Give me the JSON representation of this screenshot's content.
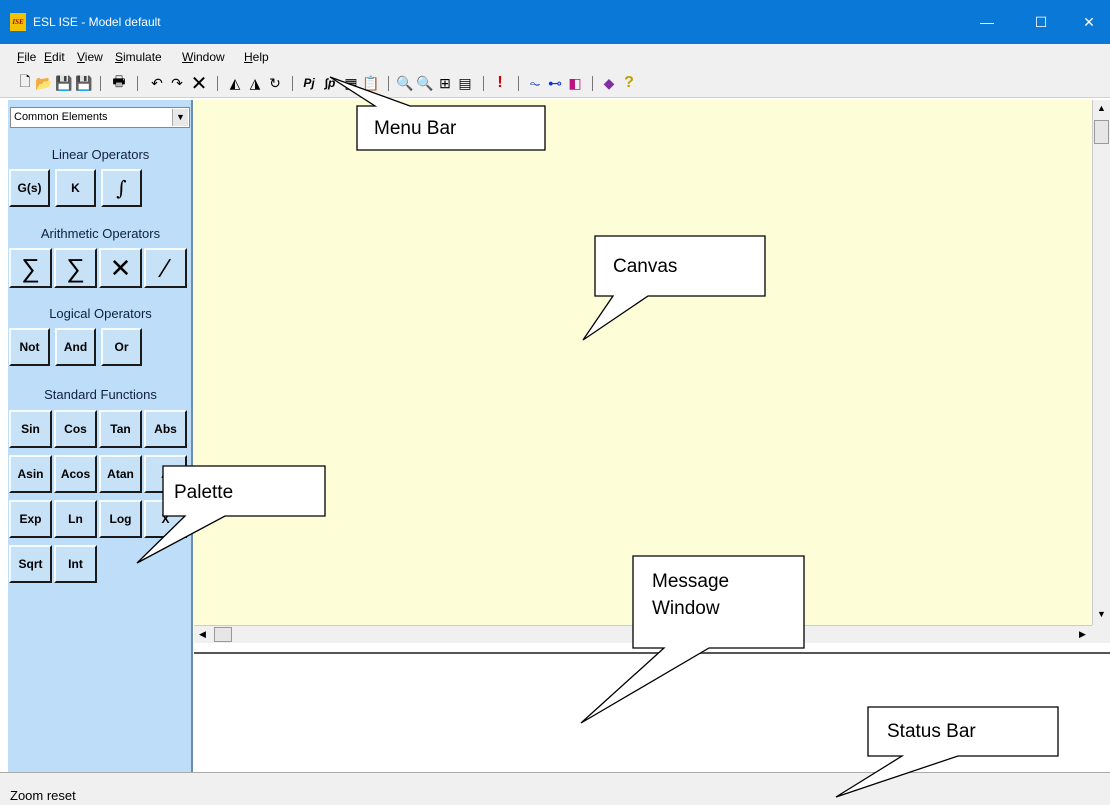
{
  "window": {
    "title": "ESL ISE - Model default",
    "app_icon_glyph": "ISE",
    "minimize_glyph": "—",
    "maximize_glyph": "☐",
    "close_glyph": "✕"
  },
  "menu": [
    {
      "underline": "F",
      "rest": "ile"
    },
    {
      "underline": "E",
      "rest": "dit"
    },
    {
      "underline": "V",
      "rest": "iew"
    },
    {
      "underline": "S",
      "rest": "imulate"
    },
    {
      "underline": "W",
      "rest": "indow"
    },
    {
      "underline": "H",
      "rest": "elp"
    }
  ],
  "toolbar": {
    "icons": [
      "new-file-icon",
      "open-file-icon",
      "save-icon",
      "save-all-icon",
      "print-icon",
      "undo-icon",
      "redo-icon",
      "delete-icon",
      "flip-horizontal-icon",
      "flip-vertical-icon",
      "rotate-icon",
      "parameters-icon",
      "integration-params-icon",
      "compile-icon",
      "properties-icon",
      "zoom-in-icon",
      "zoom-reset-icon",
      "zoom-fit-icon",
      "grid-icon",
      "run-icon",
      "plot-icon",
      "connector-icon",
      "block-3d-icon",
      "book-icon",
      "help-icon"
    ],
    "glyphs": [
      "🗋",
      "📂",
      "💾",
      "💾",
      "🖶",
      "↶",
      "↷",
      "✕",
      "◭",
      "◮",
      "↻",
      "Pj",
      "∫p",
      "▦",
      "📋",
      "🔍",
      "🔍",
      "⊞",
      "▤",
      "!",
      "⏦",
      "⊷",
      "◧",
      "◆",
      "?"
    ]
  },
  "palette": {
    "selector_value": "Common Elements",
    "sections": {
      "linear": "Linear Operators",
      "arithmetic": "Arithmetic Operators",
      "logical": "Logical Operators",
      "standard": "Standard Functions"
    },
    "buttons": {
      "gs": "G(s)",
      "k": "K",
      "integral": "∫",
      "sum": "∑",
      "sum3": "∑",
      "mult": "✕",
      "div": "∕",
      "not": "Not",
      "and": "And",
      "or": "Or",
      "sin": "Sin",
      "cos": "Cos",
      "tan": "Tan",
      "abs": "Abs",
      "asin": "Asin",
      "acos": "Acos",
      "atan": "Atan",
      "atan2": "A",
      "exp": "Exp",
      "ln": "Ln",
      "log": "Log",
      "pow": "X",
      "sqrt": "Sqrt",
      "int": "Int"
    }
  },
  "status": {
    "text": "Zoom reset"
  },
  "annotations": {
    "menu_bar": "Menu Bar",
    "canvas": "Canvas",
    "palette": "Palette",
    "message_window_line1": "Message",
    "message_window_line2": "Window",
    "status_bar": "Status Bar"
  }
}
